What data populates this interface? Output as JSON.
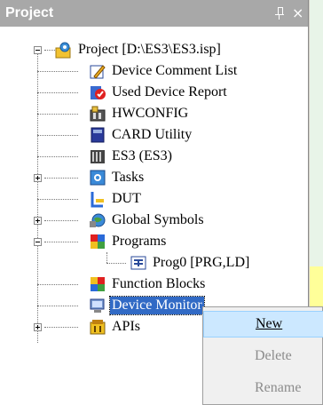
{
  "panel": {
    "title": "Project",
    "pin_icon": "pin-icon",
    "close_icon": "close-icon"
  },
  "tree": {
    "root": "Project [D:\\ES3\\ES3.isp]",
    "items": [
      {
        "label": "Device Comment List",
        "icon": "pencil-list-icon"
      },
      {
        "label": "Used Device Report",
        "icon": "report-icon"
      },
      {
        "label": "HWCONFIG",
        "icon": "hardware-icon"
      },
      {
        "label": "CARD Utility",
        "icon": "card-icon"
      },
      {
        "label": "ES3  (ES3)",
        "icon": "plc-icon"
      },
      {
        "label": "Tasks",
        "icon": "tasks-icon"
      },
      {
        "label": "DUT",
        "icon": "dut-icon"
      },
      {
        "label": "Global Symbols",
        "icon": "globe-icon"
      },
      {
        "label": "Programs",
        "icon": "programs-icon"
      },
      {
        "label": "Prog0 [PRG,LD]",
        "icon": "program-icon"
      },
      {
        "label": "Function Blocks",
        "icon": "function-blocks-icon"
      },
      {
        "label": "Device Monitor",
        "icon": "device-monitor-icon"
      },
      {
        "label": "APIs",
        "icon": "apis-icon"
      }
    ]
  },
  "context_menu": {
    "items": [
      {
        "label": "New",
        "state": "highlighted"
      },
      {
        "label": "Delete",
        "state": "disabled"
      },
      {
        "label": "Rename",
        "state": "disabled"
      }
    ]
  },
  "colors": {
    "titlebar": "#a8a8a8",
    "selection": "#316ac5",
    "menu_highlight": "#cce8ff"
  }
}
